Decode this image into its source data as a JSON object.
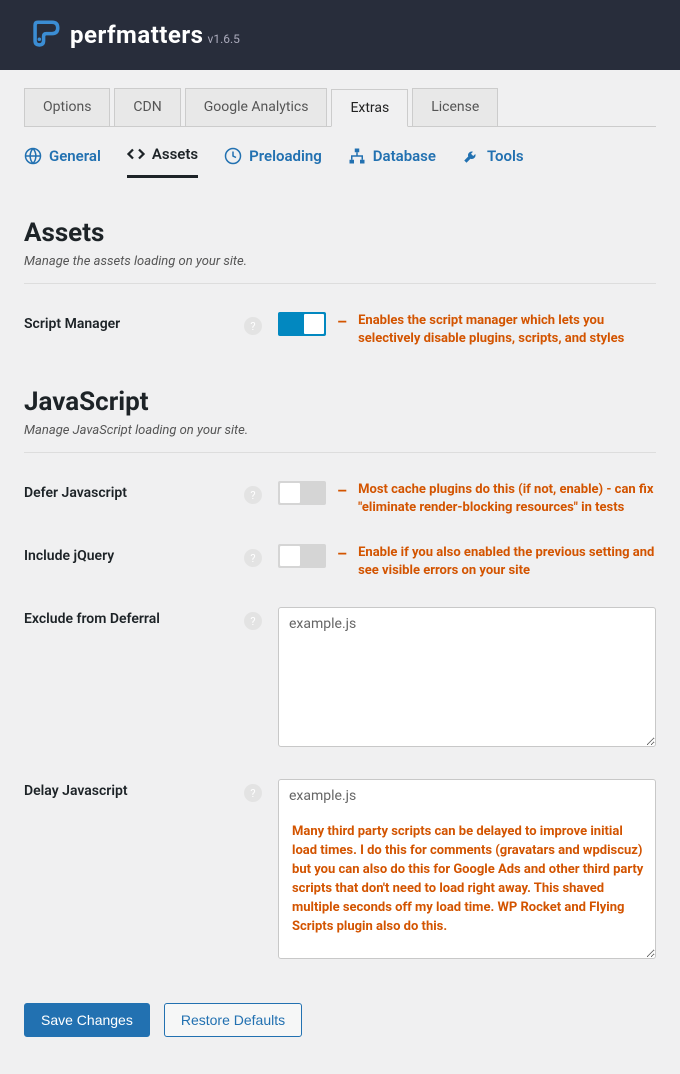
{
  "header": {
    "brand": "perfmatters",
    "version": "v1.6.5"
  },
  "top_tabs": [
    "Options",
    "CDN",
    "Google Analytics",
    "Extras",
    "License"
  ],
  "top_tabs_active": 3,
  "sub_tabs": [
    {
      "label": "General",
      "icon": "globe"
    },
    {
      "label": "Assets",
      "icon": "code"
    },
    {
      "label": "Preloading",
      "icon": "clock"
    },
    {
      "label": "Database",
      "icon": "sitemap"
    },
    {
      "label": "Tools",
      "icon": "wrench"
    }
  ],
  "sub_tabs_active": 1,
  "sections": {
    "assets": {
      "title": "Assets",
      "desc": "Manage the assets loading on your site."
    },
    "javascript": {
      "title": "JavaScript",
      "desc": "Manage JavaScript loading on your site."
    }
  },
  "fields": {
    "script_manager": {
      "label": "Script Manager",
      "on": true,
      "annot": "Enables the script manager which lets you selectively disable plugins, scripts, and styles"
    },
    "defer_js": {
      "label": "Defer Javascript",
      "on": false,
      "annot": "Most cache plugins do this (if not, enable) -  can fix \"eliminate render-blocking resources\" in tests"
    },
    "include_jquery": {
      "label": "Include jQuery",
      "on": false,
      "annot": "Enable if you also enabled the previous setting and see visible errors on your site"
    },
    "exclude_deferral": {
      "label": "Exclude from Deferral",
      "value": "example.js"
    },
    "delay_js": {
      "label": "Delay Javascript",
      "value": "example.js",
      "annot": "Many third party scripts can be delayed to improve initial load times. I do this for comments (gravatars and wpdiscuz) but you can also do this for Google Ads and other third party scripts that don't need to load right away. This shaved multiple seconds off my load time. WP Rocket and Flying Scripts plugin also do this."
    }
  },
  "buttons": {
    "save": "Save Changes",
    "restore": "Restore Defaults"
  }
}
